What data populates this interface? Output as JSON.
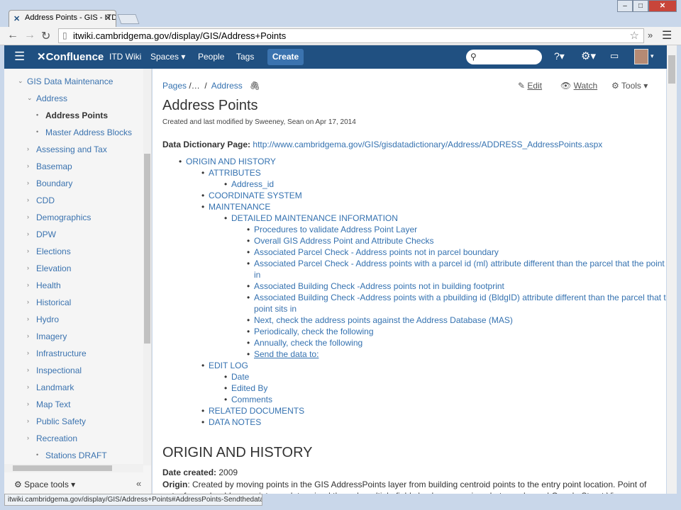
{
  "browser": {
    "tab_title": "Address Points - GIS - ITD",
    "url": "itwiki.cambridgema.gov/display/GIS/Address+Points",
    "status_url": "itwiki.cambridgema.gov/display/GIS/Address+Points#AddressPoints-Sendthedatato:"
  },
  "header": {
    "logo": "Confluence",
    "space": "ITD Wiki",
    "links": [
      "Spaces",
      "People",
      "Tags"
    ],
    "create": "Create"
  },
  "sidebar": {
    "items": [
      {
        "label": "GIS Data Maintenance",
        "level": 0,
        "expanded": true
      },
      {
        "label": "Address",
        "level": 1,
        "expanded": true
      },
      {
        "label": "Address Points",
        "level": 2,
        "current": true
      },
      {
        "label": "Master Address Blocks",
        "level": 2
      },
      {
        "label": "Assessing and Tax",
        "level": 1
      },
      {
        "label": "Basemap",
        "level": 1
      },
      {
        "label": "Boundary",
        "level": 1
      },
      {
        "label": "CDD",
        "level": 1
      },
      {
        "label": "Demographics",
        "level": 1
      },
      {
        "label": "DPW",
        "level": 1
      },
      {
        "label": "Elections",
        "level": 1
      },
      {
        "label": "Elevation",
        "level": 1
      },
      {
        "label": "Health",
        "level": 1
      },
      {
        "label": "Historical",
        "level": 1
      },
      {
        "label": "Hydro",
        "level": 1
      },
      {
        "label": "Imagery",
        "level": 1
      },
      {
        "label": "Infrastructure",
        "level": 1
      },
      {
        "label": "Inspectional",
        "level": 1
      },
      {
        "label": "Landmark",
        "level": 1
      },
      {
        "label": "Map Text",
        "level": 1
      },
      {
        "label": "Public Safety",
        "level": 1
      },
      {
        "label": "Recreation",
        "level": 1
      },
      {
        "label": "Stations DRAFT",
        "level": 2
      }
    ],
    "space_tools": "Space tools"
  },
  "page": {
    "breadcrumbs": [
      "Pages",
      "/…",
      "/",
      "Address"
    ],
    "actions": {
      "edit": "Edit",
      "watch": "Watch",
      "tools": "Tools"
    },
    "title": "Address Points",
    "meta": "Created and last modified by Sweeney, Sean on Apr 17, 2014",
    "dd_label": "Data Dictionary Page:",
    "dd_link": "http://www.cambridgema.gov/GIS/gisdatadictionary/Address/ADDRESS_AddressPoints.aspx",
    "toc": [
      {
        "text": "ORIGIN AND HISTORY",
        "level": 0
      },
      {
        "text": "ATTRIBUTES",
        "level": 1
      },
      {
        "text": "Address_id",
        "level": 2
      },
      {
        "text": "COORDINATE SYSTEM",
        "level": 1
      },
      {
        "text": "MAINTENANCE",
        "level": 1
      },
      {
        "text": "DETAILED MAINTENANCE INFORMATION",
        "level": 2
      },
      {
        "text": "Procedures to validate Address Point Layer",
        "level": 3
      },
      {
        "text": "Overall GIS Address Point and Attribute Checks",
        "level": 3
      },
      {
        "text": "Associated Parcel Check - Address points not in parcel boundary",
        "level": 3
      },
      {
        "text": "Associated Parcel Check - Address points with a parcel id (ml) attribute different than the parcel that the point sits",
        "cont": "in",
        "level": 3
      },
      {
        "text": "Associated Building Check -Address points not in building footprint",
        "level": 3
      },
      {
        "text": "Associated Building Check -Address points with a pbuilding id (BldgID) attribute different than the parcel that the",
        "cont": "point sits in",
        "level": 3
      },
      {
        "text": "Next, check the address points against the Address Database (MAS)",
        "level": 3
      },
      {
        "text": "Periodically, check the following",
        "level": 3
      },
      {
        "text": "Annually, check the following",
        "level": 3
      },
      {
        "text": "Send the data to:",
        "level": 3,
        "underline": true
      },
      {
        "text": "EDIT LOG",
        "level": 1
      },
      {
        "text": "Date",
        "level": 2
      },
      {
        "text": "Edited By",
        "level": 2
      },
      {
        "text": "Comments",
        "level": 2
      },
      {
        "text": "RELATED DOCUMENTS",
        "level": 1
      },
      {
        "text": "DATA NOTES",
        "level": 1
      }
    ],
    "section_heading": "ORIGIN AND HISTORY",
    "date_label": "Date created:",
    "date_value": "2009",
    "origin_label": "Origin",
    "origin_text": ": Created by moving points in the GIS AddressPoints layer from building centroid points to the entry point location. Point of entry for each address point was determined through multiple field checks, assessing photographs and Google Street View."
  }
}
